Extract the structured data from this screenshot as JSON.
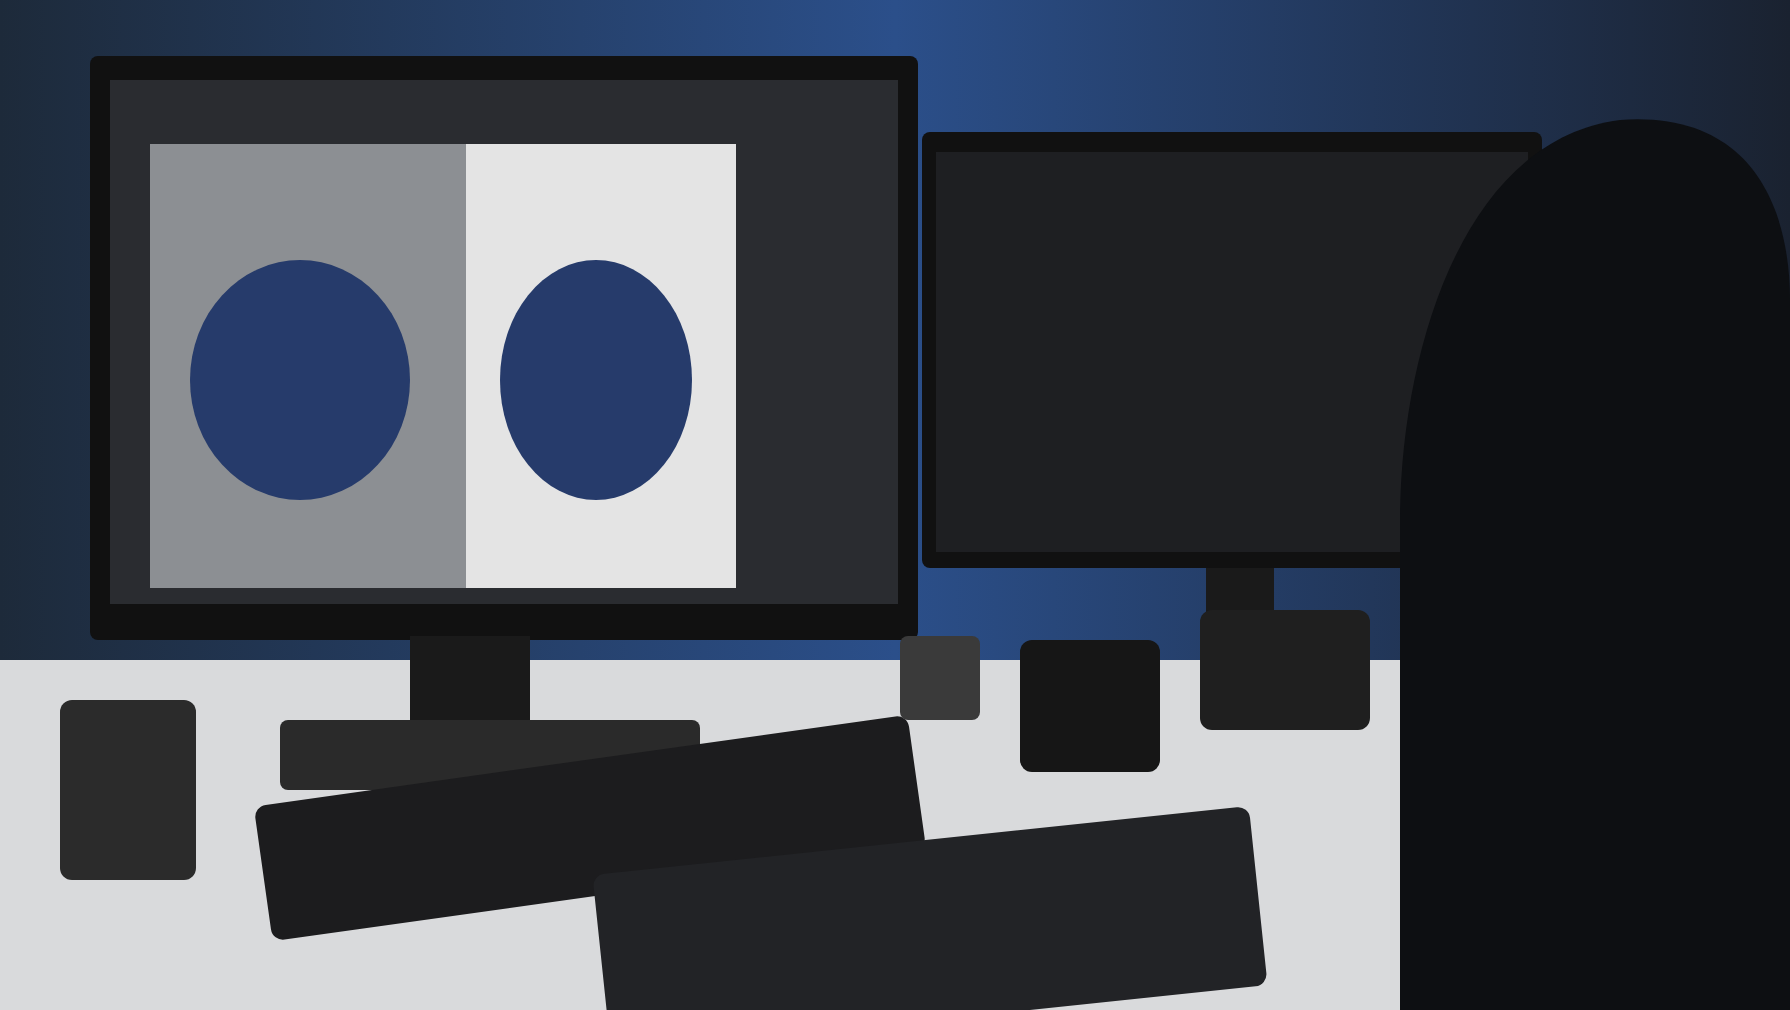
{
  "photo": {
    "kind": "photo"
  }
}
